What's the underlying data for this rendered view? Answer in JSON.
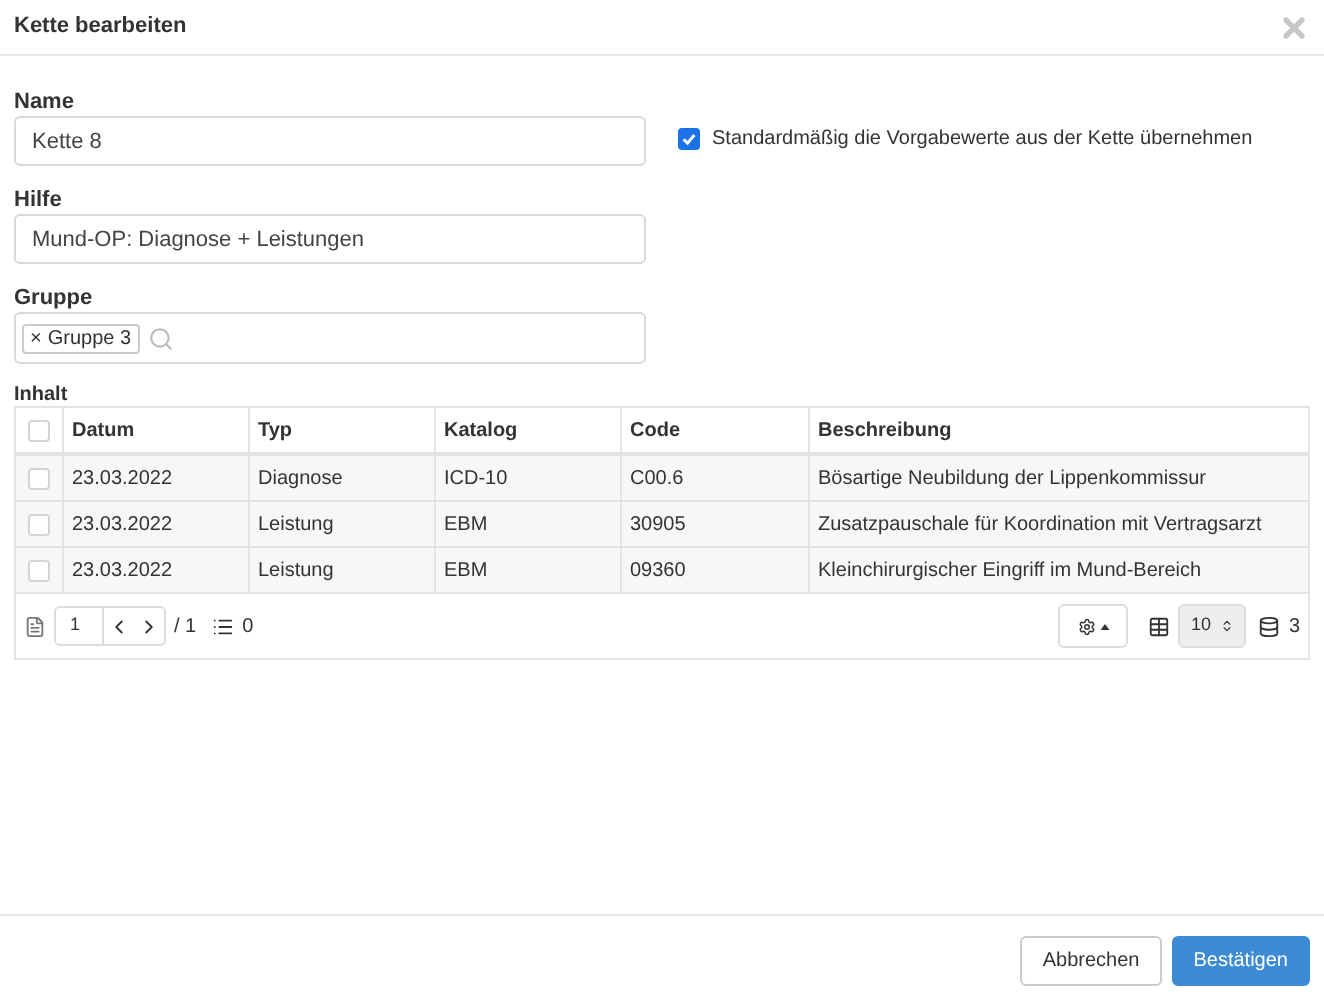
{
  "window": {
    "title": "Kette bearbeiten"
  },
  "form": {
    "name": {
      "label": "Name",
      "value": "Kette 8"
    },
    "default_checkbox": {
      "label": "Standardmäßig die Vorgabewerte aus der Kette übernehmen",
      "checked": true
    },
    "help": {
      "label": "Hilfe",
      "value": "Mund-OP: Diagnose + Leistungen"
    },
    "group": {
      "label": "Gruppe",
      "tags": [
        {
          "remove": "×",
          "label": "Gruppe 3"
        }
      ]
    }
  },
  "table": {
    "label": "Inhalt",
    "select_all": {
      "checked": false
    },
    "columns": [
      "Datum",
      "Typ",
      "Katalog",
      "Code",
      "Beschreibung"
    ],
    "rows": [
      {
        "checked": false,
        "cells": [
          "23.03.2022",
          "Diagnose",
          "ICD-10",
          "C00.6",
          "Bösartige Neubildung der Lippenkommissur"
        ]
      },
      {
        "checked": false,
        "cells": [
          "23.03.2022",
          "Leistung",
          "EBM",
          "30905",
          "Zusatzpauschale für Koordination mit Vertragsarzt"
        ]
      },
      {
        "checked": false,
        "cells": [
          "23.03.2022",
          "Leistung",
          "EBM",
          "09360",
          "Kleinchirurgischer Eingriff im Mund-Bereich"
        ]
      }
    ],
    "footer": {
      "page": "1",
      "pages": "/ 1",
      "selected_count": "0",
      "page_size": "10",
      "total": "3"
    }
  },
  "buttons": [
    {
      "label": "Abbrechen",
      "kind": "secondary"
    },
    {
      "label": "Bestätigen",
      "kind": "primary"
    }
  ]
}
